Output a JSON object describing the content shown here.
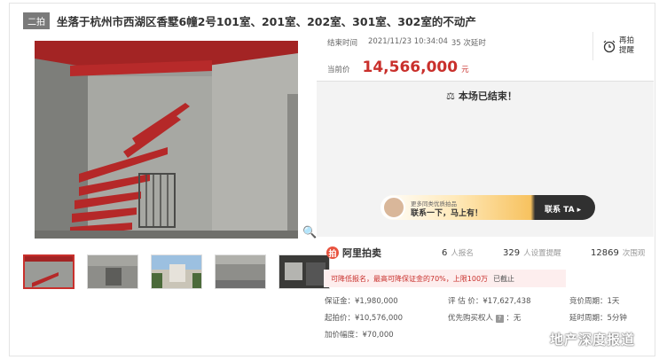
{
  "header": {
    "badge": "二拍",
    "title": "坐落于杭州市西湖区香墅6幢2号101室、201室、202室、301室、302室的不动产"
  },
  "auction": {
    "end_label": "结束时间",
    "end_time": "2021/11/23 10:34:04",
    "delays": "35 次延时",
    "remind_label": "再拍提醒",
    "price_label": "当前价",
    "price": "14,566,000",
    "price_unit": "元",
    "status": "本场已结束！"
  },
  "agent": {
    "subtitle": "更多同类优质拍品",
    "message": "联系一下，马上有！",
    "button": "联系 TA ▸"
  },
  "stats": {
    "brand": "阿里拍卖",
    "signups": "6",
    "signups_label": "人报名",
    "reminders": "329",
    "reminders_label": "人设置提醒",
    "views": "12869",
    "views_label": "次围观"
  },
  "notice": {
    "text": "可降低报名，最高可降保证金的70%，上限100万",
    "stopped": "已截止"
  },
  "details": {
    "deposit": "保证金：¥1,980,000",
    "start_price": "起拍价：¥10,576,000",
    "increment": "加价幅度：¥70,000",
    "appraisal": "评 估 价：¥17,627,438",
    "priority": "优先购买权人",
    "priority_value": "：无",
    "cycle": "竞价周期：1天",
    "delay_cycle": "延时周期：5分钟"
  },
  "watermark": "地产深度报道",
  "colors": {
    "accent": "#c9302c",
    "badge": "#7a7a7a"
  }
}
